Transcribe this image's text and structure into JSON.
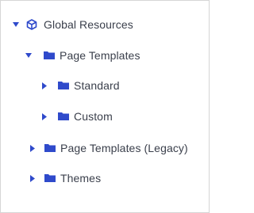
{
  "colors": {
    "accent": "#2f4acb",
    "text": "#3a3f4b",
    "border": "#d6d6d6"
  },
  "tree": {
    "root": {
      "label": "Global Resources",
      "expanded": true,
      "icon": "cube-icon",
      "children": [
        {
          "label": "Page Templates",
          "expanded": true,
          "icon": "folder-icon",
          "children": [
            {
              "label": "Standard",
              "expanded": false,
              "icon": "folder-icon"
            },
            {
              "label": "Custom",
              "expanded": false,
              "icon": "folder-icon"
            }
          ]
        },
        {
          "label": "Page Templates (Legacy)",
          "expanded": false,
          "icon": "folder-icon"
        },
        {
          "label": "Themes",
          "expanded": false,
          "icon": "folder-icon"
        }
      ]
    }
  }
}
